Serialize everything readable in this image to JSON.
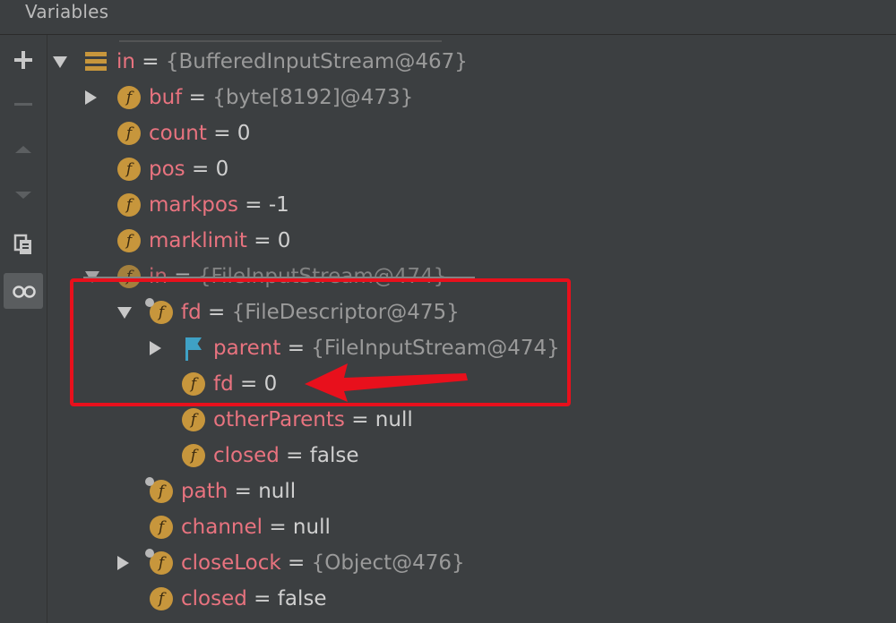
{
  "panel": {
    "title": "Variables"
  },
  "toolbar": {
    "buttons": [
      {
        "name": "add-watch-button",
        "icon": "plus-icon",
        "enabled": true
      },
      {
        "name": "remove-watch-button",
        "icon": "minus-icon",
        "enabled": false
      },
      {
        "name": "move-up-button",
        "icon": "arrow-up-icon",
        "enabled": false
      },
      {
        "name": "move-down-button",
        "icon": "arrow-down-icon",
        "enabled": false
      },
      {
        "name": "copy-button",
        "icon": "copy-icon",
        "enabled": true
      },
      {
        "name": "show-watches-toggle",
        "icon": "glasses-icon",
        "enabled": true,
        "active": true
      }
    ]
  },
  "variables": [
    {
      "name": "in",
      "value": "{BufferedInputStream@467}",
      "kind": "object",
      "icon": "stack-icon",
      "expanded": true
    },
    {
      "name": "buf",
      "value": "{byte[8192]@473}",
      "kind": "object",
      "icon": "field-icon",
      "expandable": true
    },
    {
      "name": "count",
      "value": "0",
      "kind": "primitive",
      "icon": "field-icon"
    },
    {
      "name": "pos",
      "value": "0",
      "kind": "primitive",
      "icon": "field-icon"
    },
    {
      "name": "markpos",
      "value": "-1",
      "kind": "primitive",
      "icon": "field-icon"
    },
    {
      "name": "marklimit",
      "value": "0",
      "kind": "primitive",
      "icon": "field-icon"
    },
    {
      "name": "in",
      "value": "{FileInputStream@474}",
      "kind": "object",
      "icon": "field-icon",
      "expanded": true
    },
    {
      "name": "fd",
      "value": "{FileDescriptor@475}",
      "kind": "object",
      "icon": "field-icon",
      "expanded": true
    },
    {
      "name": "parent",
      "value": "{FileInputStream@474}",
      "kind": "object",
      "icon": "flag-icon",
      "expandable": true
    },
    {
      "name": "fd",
      "value": "0",
      "kind": "primitive",
      "icon": "field-icon"
    },
    {
      "name": "otherParents",
      "value": "null",
      "kind": "primitive",
      "icon": "field-icon"
    },
    {
      "name": "closed",
      "value": "false",
      "kind": "primitive",
      "icon": "field-icon"
    },
    {
      "name": "path",
      "value": "null",
      "kind": "primitive",
      "icon": "field-icon"
    },
    {
      "name": "channel",
      "value": "null",
      "kind": "primitive",
      "icon": "field-icon"
    },
    {
      "name": "closeLock",
      "value": "{Object@476}",
      "kind": "object",
      "icon": "field-icon",
      "expandable": true
    },
    {
      "name": "closed",
      "value": "false",
      "kind": "primitive",
      "icon": "field-icon"
    }
  ],
  "eq": "=",
  "field_icon_letter": "f",
  "colors": {
    "background": "#3c3f41",
    "variable_name": "#e8737f",
    "value": "#d0d0d0",
    "object_value": "#9a9a9a",
    "field_icon": "#c7963c",
    "annotation": "#e8101c"
  }
}
